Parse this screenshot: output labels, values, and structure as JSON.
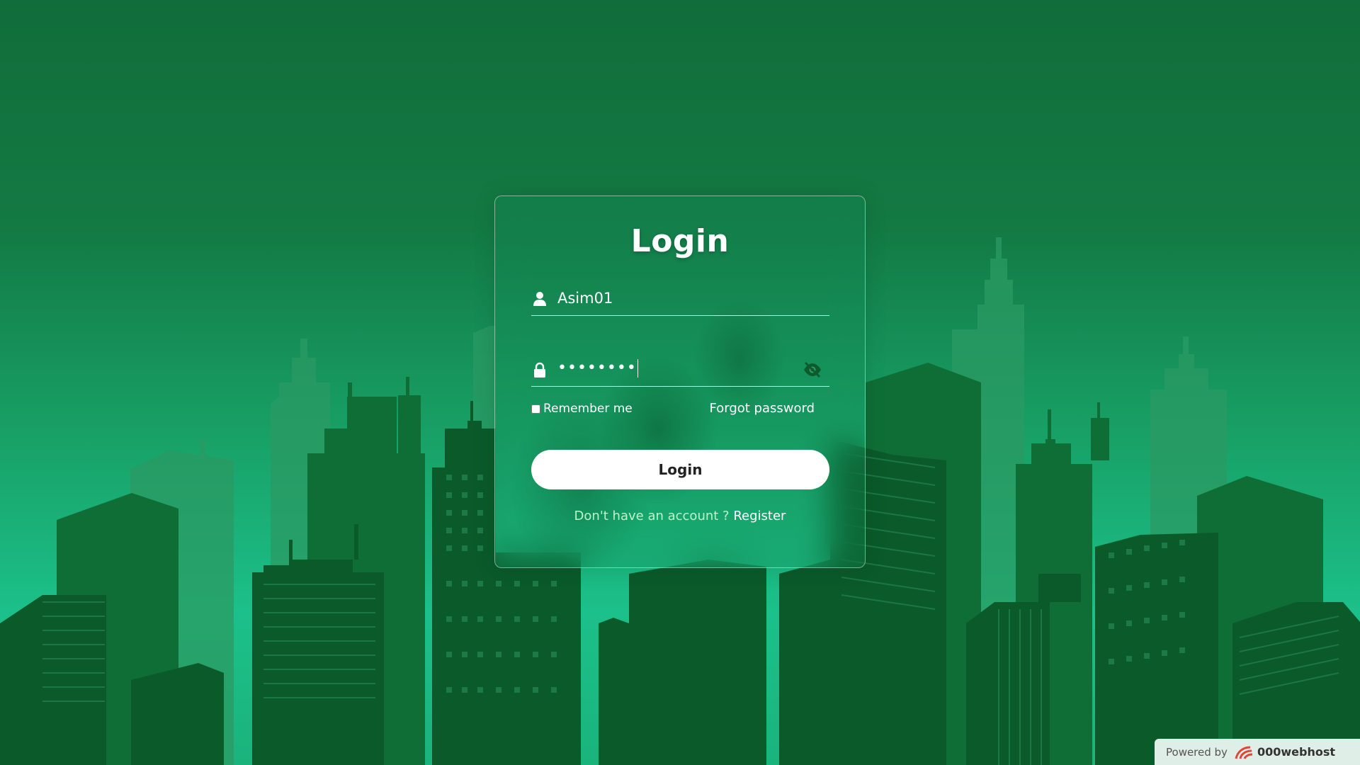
{
  "login": {
    "title": "Login",
    "username_value": "Asim01",
    "password_masked": "••••••••",
    "remember_label": "Remember me",
    "forgot_label": "Forgot password",
    "button_label": "Login",
    "register_prompt": "Don't have an account ?",
    "register_link": "Register"
  },
  "footer": {
    "powered_label": "Powered by",
    "brand": "000webhost"
  },
  "icons": {
    "username": "user-icon",
    "password": "lock-icon",
    "toggle": "eye-slash-icon",
    "brand": "webhost-logo-icon"
  },
  "colors": {
    "accent": "#1cc08a",
    "background_top": "#116d3b",
    "building_dark": "#0b5a2a",
    "button_bg": "#ffffff",
    "register_prompt": "#b8f5c8"
  }
}
